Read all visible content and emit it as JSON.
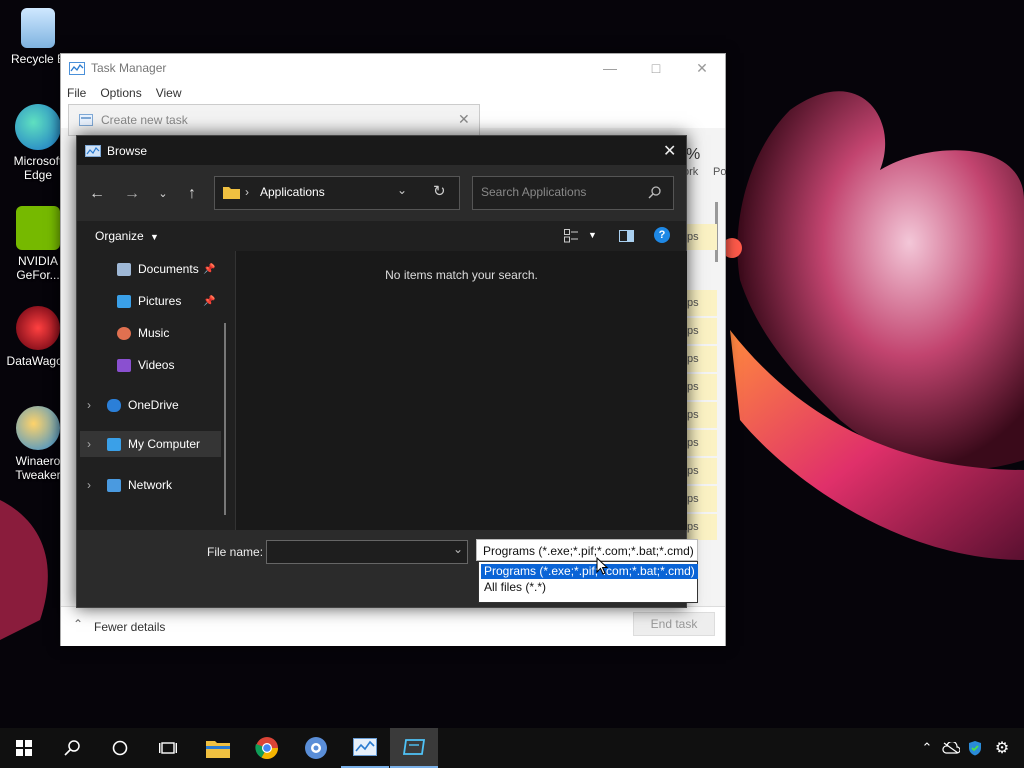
{
  "desktop": {
    "icons": [
      {
        "label": "Recycle B"
      },
      {
        "label": "Microsoft Edge"
      },
      {
        "label": "NVIDIA GeFor..."
      },
      {
        "label": "DataWagon"
      },
      {
        "label": "Winaero Tweaker"
      }
    ]
  },
  "task_manager": {
    "title": "Task Manager",
    "menu": [
      "File",
      "Options",
      "View"
    ],
    "col_header_pct": "%",
    "col_header_work": "ork",
    "col_header_p": "Po",
    "row_cell": "ps",
    "fewer_details": "Fewer details",
    "end_task": "End task"
  },
  "create_task": {
    "title": "Create new task"
  },
  "browse": {
    "title": "Browse",
    "address": "Applications",
    "search_placeholder": "Search Applications",
    "organize": "Organize",
    "empty_message": "No items match your search.",
    "nav_items": [
      {
        "label": "Documents",
        "pinned": true
      },
      {
        "label": "Pictures",
        "pinned": true
      },
      {
        "label": "Music"
      },
      {
        "label": "Videos"
      },
      {
        "label": "OneDrive"
      },
      {
        "label": "My Computer",
        "selected": true
      },
      {
        "label": "Network"
      }
    ],
    "file_name_label": "File name:",
    "file_name_value": ""
  },
  "file_type": {
    "selected": "Programs (*.exe;*.pif;*.com;*.bat;*.cmd)",
    "options": [
      {
        "label": "Programs (*.exe;*.pif;*.com;*.bat;*.cmd)",
        "highlighted": true
      },
      {
        "label": "All files (*.*)"
      }
    ]
  },
  "colors": {
    "accent": "#0078d7",
    "dialog_bg": "#191919",
    "highlight": "#0a64d6"
  }
}
